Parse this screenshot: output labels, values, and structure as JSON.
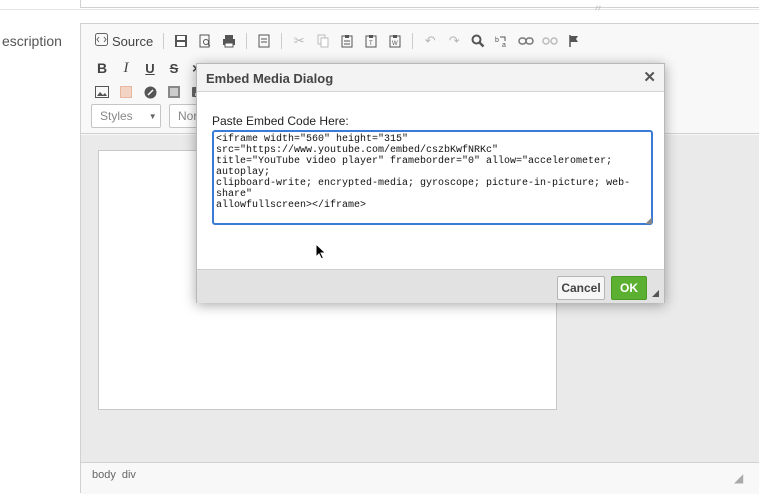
{
  "field": {
    "label": "escription"
  },
  "toolbar": {
    "source_label": "Source",
    "styles_placeholder": "Styles",
    "format_placeholder": "Norm"
  },
  "statusbar": {
    "path": [
      "body",
      "div"
    ]
  },
  "dialog": {
    "title": "Embed Media Dialog",
    "close_symbol": "✕",
    "field_label": "Paste Embed Code Here:",
    "embed_code": "<iframe width=\"560\" height=\"315\" src=\"https://www.youtube.com/embed/cszbKwfNRKc\"\ntitle=\"YouTube video player\" frameborder=\"0\" allow=\"accelerometer; autoplay;\nclipboard-write; encrypted-media; gyroscope; picture-in-picture; web-share\"\nallowfullscreen></iframe>",
    "cancel_label": "Cancel",
    "ok_label": "OK"
  },
  "colors": {
    "ok_button": "#5cb031",
    "textarea_focus": "#3a7bd5"
  }
}
